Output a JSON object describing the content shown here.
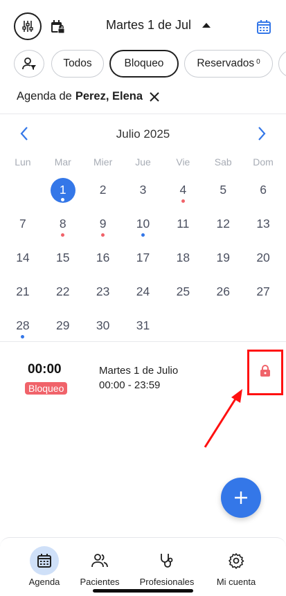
{
  "header": {
    "title": "Martes 1 de Jul"
  },
  "filters": {
    "chips": [
      {
        "label": "Todos",
        "active": false
      },
      {
        "label": "Bloqueo",
        "active": true
      },
      {
        "label": "Reservados",
        "count": "0",
        "active": false
      }
    ]
  },
  "agenda": {
    "prefix": "Agenda de",
    "person": "Perez, Elena"
  },
  "calendar": {
    "month": "Julio 2025",
    "weekdays": [
      "Lun",
      "Mar",
      "Mier",
      "Jue",
      "Vie",
      "Sab",
      "Dom"
    ],
    "start_offset": 1,
    "days": 31,
    "selected": 1,
    "dots": {
      "1": "#ffffff",
      "4": "#f0636a",
      "8": "#f0636a",
      "9": "#f0636a",
      "10": "#3477e8",
      "28": "#3477e8"
    }
  },
  "event": {
    "time": "00:00",
    "badge": "Bloqueo",
    "date": "Martes 1 de Julio",
    "range": "00:00 - 23:59",
    "icon": "lock-icon"
  },
  "colors": {
    "accent": "#3477e8",
    "block": "#f0636a",
    "highlight_box": "#ff1010",
    "annotation_arrow": "#ff1010"
  },
  "bottom_nav": {
    "items": [
      {
        "label": "Agenda",
        "icon": "calendar-icon",
        "active": true
      },
      {
        "label": "Pacientes",
        "icon": "users-icon",
        "active": false
      },
      {
        "label": "Profesionales",
        "icon": "stethoscope-icon",
        "active": false
      },
      {
        "label": "Mi cuenta",
        "icon": "gear-icon",
        "active": false
      }
    ]
  }
}
